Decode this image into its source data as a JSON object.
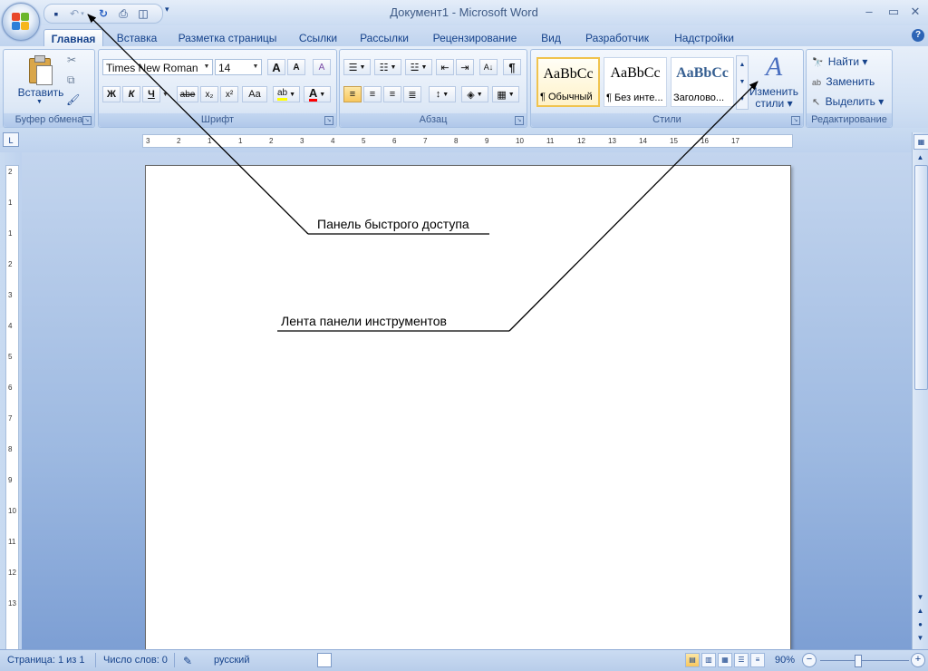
{
  "window": {
    "title": "Документ1 - Microsoft Word",
    "minimize_label": "–",
    "restore_label": "▭",
    "close_label": "✕"
  },
  "quick_access": {
    "save_glyph": "▪",
    "undo_glyph": "↶",
    "redo_glyph": "↻",
    "print_glyph": "⎙",
    "preview_glyph": "◫",
    "customize_glyph": "▾"
  },
  "tabs": [
    {
      "label": "Главная",
      "active": true
    },
    {
      "label": "Вставка"
    },
    {
      "label": "Разметка страницы"
    },
    {
      "label": "Ссылки"
    },
    {
      "label": "Рассылки"
    },
    {
      "label": "Рецензирование"
    },
    {
      "label": "Вид"
    },
    {
      "label": "Разработчик"
    },
    {
      "label": "Надстройки"
    }
  ],
  "help_label": "?",
  "ribbon": {
    "clipboard": {
      "label": "Буфер обмена",
      "paste_label": "Вставить",
      "cut_glyph": "✂",
      "copy_glyph": "⧉",
      "format_painter_glyph": "🖌"
    },
    "font": {
      "label": "Шрифт",
      "font_name": "Times New Roman",
      "font_size": "14",
      "grow_label": "A",
      "shrink_label": "A",
      "clear_label": "A",
      "bold_label": "Ж",
      "italic_label": "К",
      "underline_label": "Ч",
      "strike_label": "abe",
      "subscript_label": "x₂",
      "superscript_label": "x²",
      "case_label": "Aa",
      "highlight_label": "ab",
      "font_color_label": "A",
      "highlight_color": "#ffff00",
      "font_color": "#ff0000"
    },
    "paragraph": {
      "label": "Абзац",
      "pilcrow_label": "¶",
      "sort_label": "А↓"
    },
    "styles": {
      "label": "Стили",
      "items": [
        {
          "sample": "AaBbCc",
          "name": "¶ Обычный",
          "selected": true
        },
        {
          "sample": "AaBbCc",
          "name": "¶ Без инте..."
        },
        {
          "sample": "AaBbCc",
          "name": "Заголово...",
          "heading": true
        }
      ],
      "change_styles_line1": "Изменить",
      "change_styles_line2": "стили ▾",
      "change_styles_glyph": "A"
    },
    "editing": {
      "label": "Редактирование",
      "find_label": "Найти ▾",
      "replace_label": "Заменить",
      "select_label": "Выделить ▾",
      "find_glyph": "🔭",
      "replace_glyph": "ab",
      "select_glyph": "↖"
    }
  },
  "ruler": {
    "corner_glyph": "L",
    "h_labels": [
      "3",
      "2",
      "1",
      "1",
      "2",
      "3",
      "4",
      "5",
      "6",
      "7",
      "8",
      "9",
      "10",
      "11",
      "12",
      "13",
      "14",
      "15",
      "16",
      "17"
    ],
    "v_labels": [
      "2",
      "1",
      "1",
      "2",
      "3",
      "4",
      "5",
      "6",
      "7",
      "8",
      "9",
      "10",
      "11",
      "12",
      "13"
    ]
  },
  "annotations": {
    "qat_label": "Панель быстрого доступа",
    "ribbon_label": "Лента панели инструментов"
  },
  "status": {
    "page": "Страница: 1 из 1",
    "words": "Число слов: 0",
    "language": "русский",
    "zoom": "90%",
    "zoom_minus": "−",
    "zoom_plus": "+"
  },
  "colors": {
    "accent": "#15428b",
    "selected_style": "#f0c34e"
  }
}
